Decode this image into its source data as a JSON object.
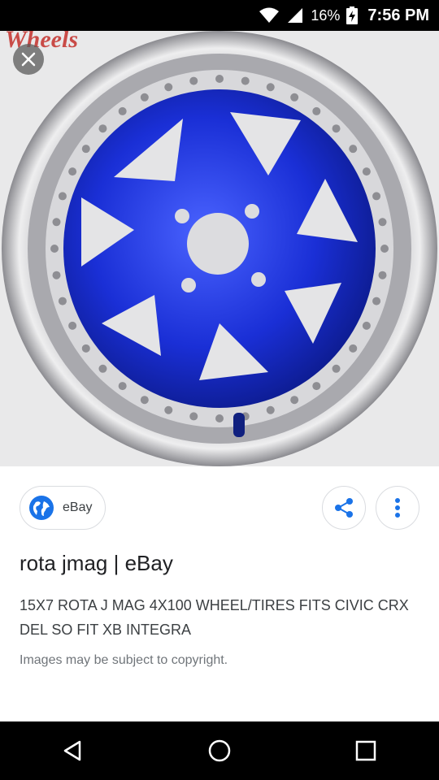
{
  "status_bar": {
    "battery_percent": "16%",
    "time": "7:56 PM",
    "icons": [
      "wifi-icon",
      "cell-signal-icon",
      "battery-charging-icon"
    ]
  },
  "image": {
    "brand_text": "Wheels",
    "colors": {
      "wheel_face": "#1a2fd6",
      "lip": "#c9c9cc",
      "background": "#e9e9ea"
    }
  },
  "viewer": {
    "close_icon": "close-icon",
    "source": {
      "name": "eBay",
      "icon": "globe-icon"
    },
    "share_icon": "share-icon",
    "more_icon": "more-vert-icon",
    "title": "rota jmag | eBay",
    "description": "15X7 ROTA J MAG 4X100 WHEEL/TIRES FITS CIVIC CRX DEL SO FIT XB INTEGRA",
    "copyright": "Images may be subject to copyright."
  },
  "nav_bar": {
    "icons": [
      "back-icon",
      "home-icon",
      "recents-icon"
    ]
  },
  "theme": {
    "accent": "#1a73e8"
  }
}
